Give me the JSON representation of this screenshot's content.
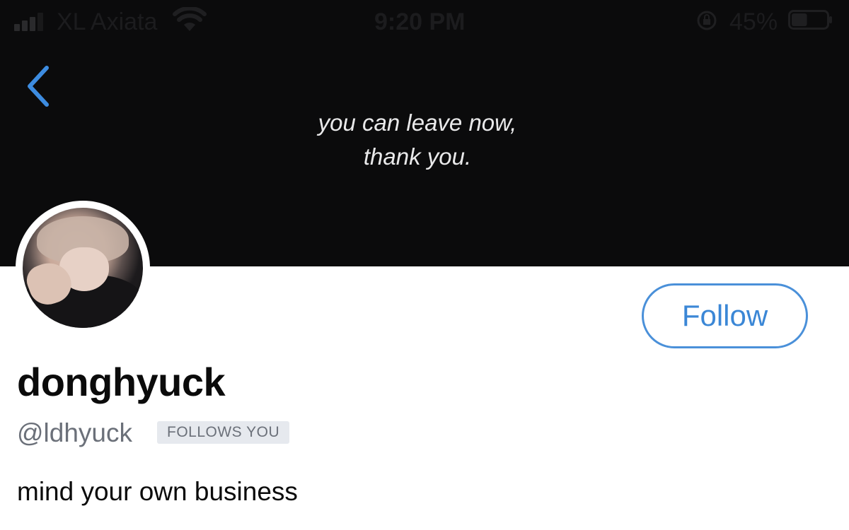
{
  "status_bar": {
    "carrier": "XL Axiata",
    "time": "9:20 PM",
    "battery_percent": "45%",
    "battery_level": 0.45,
    "signal_bars_filled": 3
  },
  "banner": {
    "line1": "you can leave now,",
    "line2": "thank you."
  },
  "profile": {
    "display_name": "donghyuck",
    "handle": "@ldhyuck",
    "follows_you_badge": "FOLLOWS YOU",
    "bio": "mind your own business",
    "follow_label": "Follow"
  },
  "colors": {
    "accent": "#4a90d9",
    "banner_bg": "#0b0b0c",
    "muted_text": "#6b7079"
  }
}
